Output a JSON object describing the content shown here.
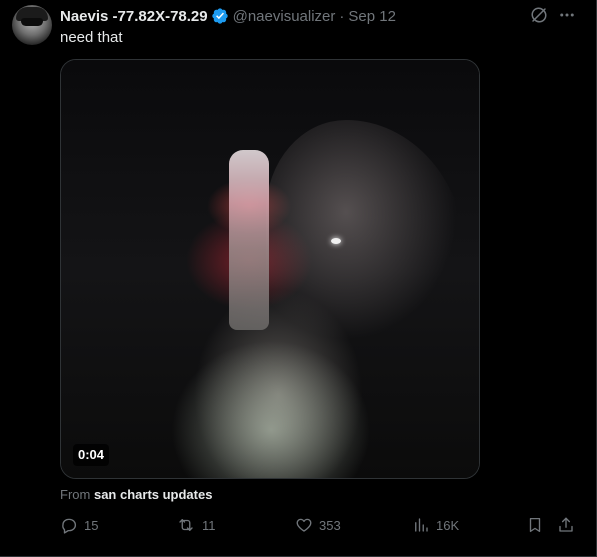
{
  "author": {
    "display_name": "Naevis -77.82X-78.29",
    "handle": "@naevisualizer",
    "separator": "·",
    "date": "Sep 12",
    "verified": true
  },
  "tweet": {
    "text": "need that"
  },
  "media": {
    "type": "video",
    "duration": "0:04"
  },
  "source": {
    "prefix": "From",
    "account": "san charts updates"
  },
  "actions": {
    "replies": "15",
    "reposts": "11",
    "likes": "353",
    "views": "16K"
  },
  "icons": {
    "verified": "verified-badge-icon",
    "grok": "grok-icon",
    "more": "more-icon",
    "reply": "reply-icon",
    "repost": "repost-icon",
    "like": "like-icon",
    "views": "views-icon",
    "bookmark": "bookmark-icon",
    "share": "share-icon"
  },
  "colors": {
    "background": "#000000",
    "text_primary": "#e7e9ea",
    "text_secondary": "#71767b",
    "verified_blue": "#1d9bf0",
    "border": "#2f3336"
  }
}
